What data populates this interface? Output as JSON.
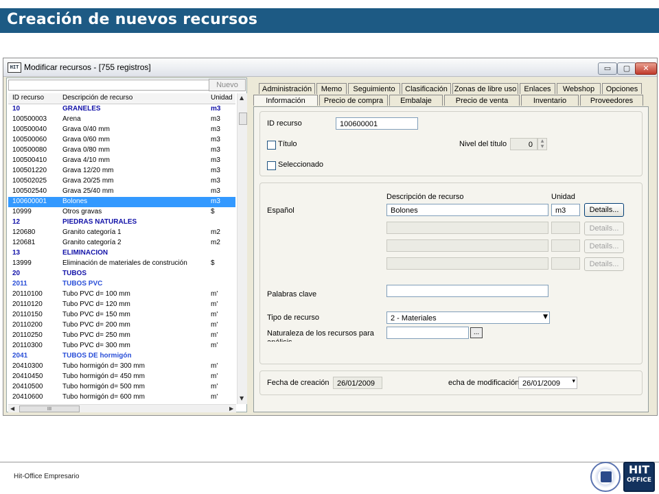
{
  "page": {
    "title": "Creación de nuevos recursos",
    "footer": "Hit-Office Empresario"
  },
  "window": {
    "app_icon_text": "HIT",
    "title": "Modificar recursos - [755 registros]",
    "controls": {
      "minimize": "▭",
      "restore": "▢",
      "close": "✕"
    }
  },
  "list": {
    "search_value": "",
    "new_button": "Nuevo",
    "headers": {
      "id": "ID recurso",
      "desc": "Descripción de recurso",
      "unit": "Unidad"
    },
    "scroll_thumb": "III",
    "rows": [
      {
        "id": "10",
        "desc": "GRANELES",
        "unit": "m3",
        "kind": "group"
      },
      {
        "id": "100500003",
        "desc": "Arena",
        "unit": "m3",
        "kind": "item"
      },
      {
        "id": "100500040",
        "desc": "Grava 0/40 mm",
        "unit": "m3",
        "kind": "item"
      },
      {
        "id": "100500060",
        "desc": "Grava 0/60 mm",
        "unit": "m3",
        "kind": "item"
      },
      {
        "id": "100500080",
        "desc": "Grava 0/80 mm",
        "unit": "m3",
        "kind": "item"
      },
      {
        "id": "100500410",
        "desc": "Grava 4/10 mm",
        "unit": "m3",
        "kind": "item"
      },
      {
        "id": "100501220",
        "desc": "Grava 12/20 mm",
        "unit": "m3",
        "kind": "item"
      },
      {
        "id": "100502025",
        "desc": "Grava 20/25 mm",
        "unit": "m3",
        "kind": "item"
      },
      {
        "id": "100502540",
        "desc": "Grava 25/40 mm",
        "unit": "m3",
        "kind": "item"
      },
      {
        "id": "100600001",
        "desc": "Bolones",
        "unit": "m3",
        "kind": "selected"
      },
      {
        "id": "10999",
        "desc": "Otros gravas",
        "unit": "$",
        "kind": "item"
      },
      {
        "id": "12",
        "desc": "PIEDRAS NATURALES",
        "unit": "",
        "kind": "group"
      },
      {
        "id": "120680",
        "desc": "Granito categoría 1",
        "unit": "m2",
        "kind": "item"
      },
      {
        "id": "120681",
        "desc": "Granito categoría 2",
        "unit": "m2",
        "kind": "item"
      },
      {
        "id": "13",
        "desc": "ELIMINACION",
        "unit": "",
        "kind": "group"
      },
      {
        "id": "13999",
        "desc": "Eliminación de materiales de construción",
        "unit": "$",
        "kind": "item"
      },
      {
        "id": "20",
        "desc": "TUBOS",
        "unit": "",
        "kind": "group"
      },
      {
        "id": "2011",
        "desc": "TUBOS PVC",
        "unit": "",
        "kind": "subgroup"
      },
      {
        "id": "20110100",
        "desc": "Tubo PVC  d= 100 mm",
        "unit": "m'",
        "kind": "item"
      },
      {
        "id": "20110120",
        "desc": "Tubo PVC  d= 120 mm",
        "unit": "m'",
        "kind": "item"
      },
      {
        "id": "20110150",
        "desc": "Tubo PVC  d= 150 mm",
        "unit": "m'",
        "kind": "item"
      },
      {
        "id": "20110200",
        "desc": "Tubo PVC  d= 200 mm",
        "unit": "m'",
        "kind": "item"
      },
      {
        "id": "20110250",
        "desc": "Tubo PVC  d= 250 mm",
        "unit": "m'",
        "kind": "item"
      },
      {
        "id": "20110300",
        "desc": "Tubo PVC  d= 300 mm",
        "unit": "m'",
        "kind": "item"
      },
      {
        "id": "2041",
        "desc": "TUBOS DE hormigón",
        "unit": "",
        "kind": "subgroup"
      },
      {
        "id": "20410300",
        "desc": "Tubo hormigón  d= 300 mm",
        "unit": "m'",
        "kind": "item"
      },
      {
        "id": "20410450",
        "desc": "Tubo hormigón  d= 450 mm",
        "unit": "m'",
        "kind": "item"
      },
      {
        "id": "20410500",
        "desc": "Tubo hormigón  d= 500 mm",
        "unit": "m'",
        "kind": "item"
      },
      {
        "id": "20410600",
        "desc": "Tubo hormigón  d= 600 mm",
        "unit": "m'",
        "kind": "item"
      }
    ]
  },
  "tabs": {
    "row1": [
      "Administración",
      "Memo",
      "Seguimiento",
      "Clasificación",
      "Zonas de libre uso",
      "Enlaces",
      "Webshop",
      "Opciones"
    ],
    "row2": [
      "Información",
      "Precio de compra",
      "Embalaje",
      "Precio de venta",
      "Inventario",
      "Proveedores"
    ],
    "active": "Información"
  },
  "info": {
    "id_label": "ID recurso",
    "id_value": "100600001",
    "titulo_label": "Título",
    "nivel_label": "Nivel del título",
    "nivel_value": "0",
    "seleccionado_label": "Seleccionado",
    "desc_header": "Descripción de recurso",
    "unit_header": "Unidad",
    "lang_label": "Español",
    "desc_value": "Bolones",
    "unit_value": "m3",
    "details_label": "Details...",
    "keywords_label": "Palabras clave",
    "keywords_value": "",
    "type_label": "Tipo de recurso",
    "type_value": "2  -  Materiales",
    "nature_label": "Naturaleza de los recursos para",
    "nature_label_cut": "análisis",
    "nature_value": "",
    "ellipsis": "...",
    "created_label": "Fecha de creación",
    "created_value": "26/01/2009",
    "modified_label": "echa de modificación",
    "modified_value": "26/01/2009"
  },
  "logo": {
    "line1": "HIT",
    "line2": "OFFICE"
  },
  "colors": {
    "banner": "#1d5a84",
    "group_text": "#1212a8",
    "subgroup_text": "#2a4fd8",
    "selection": "#3399ff"
  }
}
